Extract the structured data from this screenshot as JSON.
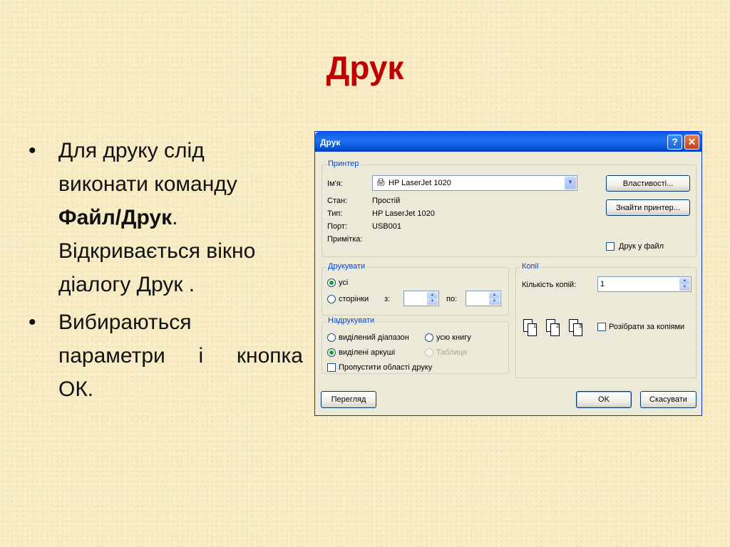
{
  "slide": {
    "title": "Друк",
    "bullet1": {
      "l1": "Для друку слід",
      "l2": "виконати команду",
      "l3_bold": "Файл/Друк",
      "l3_tail": ".",
      "l4": "Відкривається вікно",
      "l5": "діалогу Друк ."
    },
    "bullet2": {
      "l1": "Вибираються",
      "l2": "параметри і кнопка",
      "l3": "ОК."
    },
    "bullet_char": "•"
  },
  "dialog": {
    "title": "Друк",
    "help_btn": "?",
    "close_btn": "✕",
    "printer": {
      "legend": "Принтер",
      "name_label": "Ім'я:",
      "name_value": "HP LaserJet 1020",
      "status_label": "Стан:",
      "status_value": "Простій",
      "type_label": "Тип:",
      "type_value": "HP LaserJet 1020",
      "port_label": "Порт:",
      "port_value": "USB001",
      "note_label": "Примітка:",
      "properties_btn": "Властивості...",
      "find_btn": "Знайти принтер...",
      "to_file": "Друк у файл"
    },
    "print_range": {
      "legend": "Друкувати",
      "all": "усі",
      "pages": "сторінки",
      "from": "з:",
      "to": "по:"
    },
    "print_what": {
      "legend": "Надрукувати",
      "selection": "виділений діапазон",
      "workbook": "усю книгу",
      "sheets": "виділені аркуші",
      "table": "Таблиця",
      "ignore_areas": "Пропустити області друку"
    },
    "copies": {
      "legend": "Копії",
      "count_label": "Кількість копій:",
      "count_value": "1",
      "collate": "Розібрати за копіями",
      "page_numbers": [
        "1",
        "1",
        "2",
        "2",
        "3",
        "3"
      ]
    },
    "preview_btn": "Перегляд",
    "ok_btn": "OK",
    "cancel_btn": "Скасувати"
  },
  "colors": {
    "title": "#c00000",
    "xp_blue": "#0052d8",
    "dialog_bg": "#ece9d8",
    "legend": "#0046d5"
  }
}
